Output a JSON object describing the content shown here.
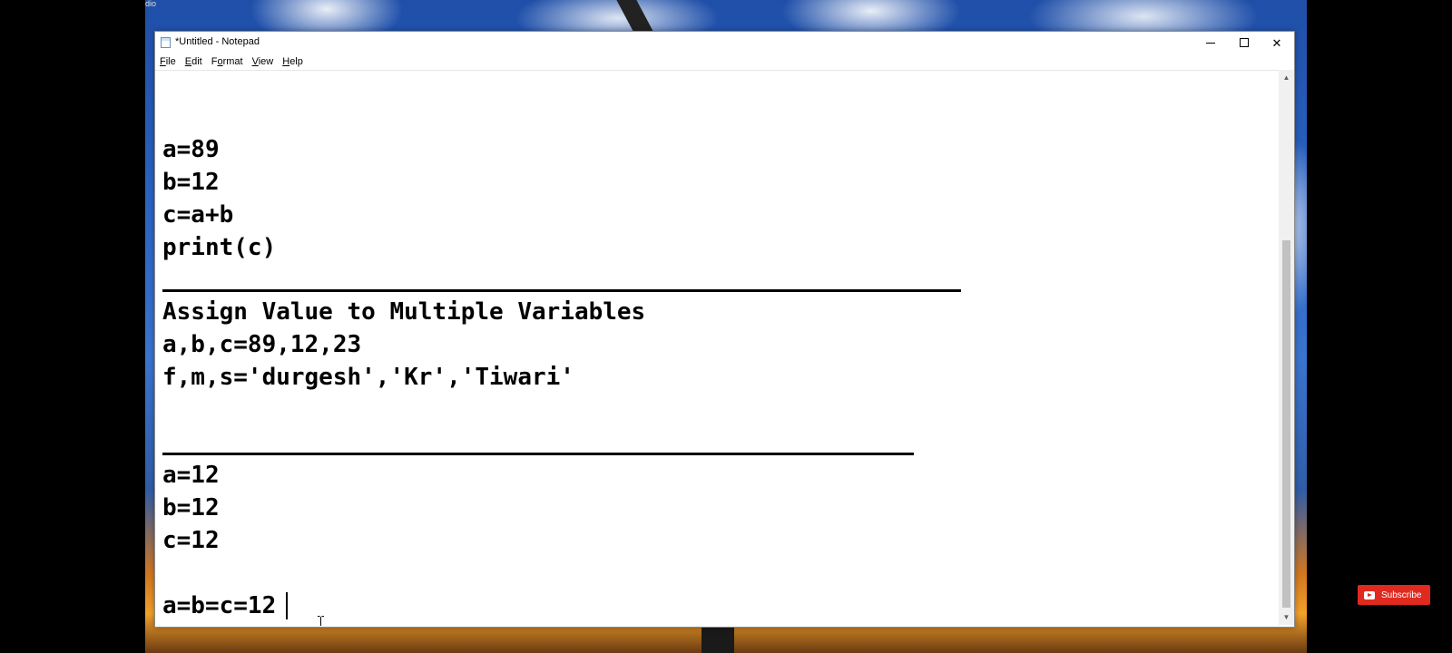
{
  "corner_text": "dio",
  "window": {
    "title": "*Untitled - Notepad",
    "minimize_icon": "minimize-icon",
    "maximize_icon": "maximize-icon",
    "close_label": "✕"
  },
  "menu": {
    "items": [
      {
        "underline": "F",
        "rest": "ile"
      },
      {
        "underline": "E",
        "rest": "dit"
      },
      {
        "underline": "o",
        "pre": "F",
        "rest": "rmat"
      },
      {
        "underline": "V",
        "rest": "iew"
      },
      {
        "underline": "H",
        "rest": "elp"
      }
    ],
    "file": "File",
    "edit": "Edit",
    "format": "Format",
    "view": "View",
    "help": "Help"
  },
  "editor": {
    "lines": {
      "l1": "a=89",
      "l2": "b=12",
      "l3": "c=a+b",
      "l4": "print(c)",
      "l5": "Assign Value to Multiple Variables",
      "l6": "a,b,c=89,12,23",
      "l7": "f,m,s='durgesh','Kr','Tiwari'",
      "l8": "a=12",
      "l9": "b=12",
      "l10": "c=12",
      "l11": "a=b=c=12"
    }
  },
  "overlay": {
    "subscribe_label": "Subscribe"
  },
  "colors": {
    "subscribe_red": "#e02a20",
    "editor_bg": "#ffffff",
    "text": "#000000"
  }
}
